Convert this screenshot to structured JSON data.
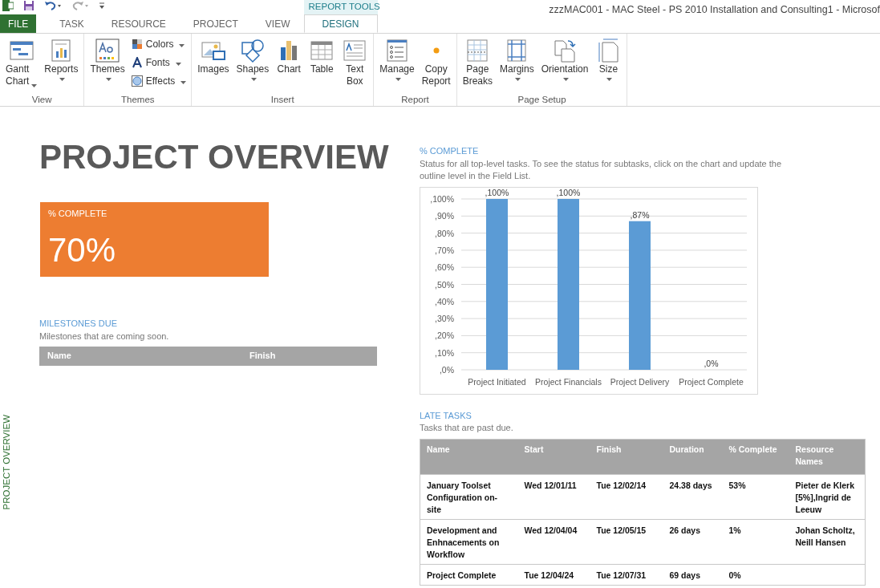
{
  "window": {
    "title": "zzzMAC001 - MAC Steel - PS 2010 Installation and Consulting1 - Microsof",
    "context_tab": "REPORT TOOLS"
  },
  "tabs": [
    {
      "label": "FILE",
      "kind": "file",
      "selected": false
    },
    {
      "label": "TASK",
      "kind": "tab",
      "selected": false
    },
    {
      "label": "RESOURCE",
      "kind": "tab",
      "selected": false
    },
    {
      "label": "PROJECT",
      "kind": "tab",
      "selected": false
    },
    {
      "label": "VIEW",
      "kind": "tab",
      "selected": false
    },
    {
      "label": "DESIGN",
      "kind": "context",
      "selected": true
    }
  ],
  "ribbon": [
    {
      "group": "View",
      "buttons": [
        {
          "label": "Gantt Chart",
          "kind": "large",
          "dropdown": true
        },
        {
          "label": "Reports",
          "kind": "large",
          "dropdown": true
        }
      ]
    },
    {
      "group": "Themes",
      "buttons": [
        {
          "label": "Themes",
          "kind": "large",
          "dropdown": true
        },
        {
          "label": "Colors",
          "kind": "small",
          "dropdown": true
        },
        {
          "label": "Fonts",
          "kind": "small",
          "dropdown": true
        },
        {
          "label": "Effects",
          "kind": "small",
          "dropdown": true
        }
      ]
    },
    {
      "group": "Insert",
      "buttons": [
        {
          "label": "Images",
          "kind": "large",
          "dropdown": false
        },
        {
          "label": "Shapes",
          "kind": "large",
          "dropdown": true
        },
        {
          "label": "Chart",
          "kind": "large",
          "dropdown": false
        },
        {
          "label": "Table",
          "kind": "large",
          "dropdown": false
        },
        {
          "label": "Text Box",
          "kind": "large",
          "dropdown": false
        }
      ]
    },
    {
      "group": "Report",
      "buttons": [
        {
          "label": "Manage",
          "kind": "large",
          "dropdown": true
        },
        {
          "label": "Copy Report",
          "kind": "large",
          "dropdown": false
        }
      ]
    },
    {
      "group": "Page Setup",
      "buttons": [
        {
          "label": "Page Breaks",
          "kind": "large",
          "dropdown": false
        },
        {
          "label": "Margins",
          "kind": "large",
          "dropdown": true
        },
        {
          "label": "Orientation",
          "kind": "large",
          "dropdown": true
        },
        {
          "label": "Size",
          "kind": "large",
          "dropdown": true
        }
      ]
    }
  ],
  "side_label": "PROJECT OVERVIEW",
  "report": {
    "title": "PROJECT OVERVIEW",
    "complete_tile": {
      "label": "% COMPLETE",
      "value": "70%",
      "color": "#ed7d31"
    },
    "milestones": {
      "heading": "MILESTONES DUE",
      "description": "Milestones that are coming soon.",
      "columns": [
        "Name",
        "Finish"
      ]
    },
    "percent_chart": {
      "heading": "% COMPLETE",
      "description": "Status for all top-level tasks. To see the status for subtasks, click on the chart and update the outline level in the Field List.",
      "chart_data": {
        "type": "bar",
        "categories": [
          "Project Initiated",
          "Project Financials",
          "Project Delivery",
          "Project Complete"
        ],
        "series": [
          {
            "color": "#5b9bd5",
            "values": [
              1,
              1,
              0.87,
              0
            ]
          }
        ],
        "grid": true,
        "ylim": [
          0,
          1
        ],
        "yticks": [
          {
            "value": 0,
            "label": ",0%"
          },
          {
            "value": 0.1,
            "label": ",10%"
          },
          {
            "value": 0.2,
            "label": ",20%"
          },
          {
            "value": 0.3,
            "label": ",30%"
          },
          {
            "value": 0.4,
            "label": ",40%"
          },
          {
            "value": 0.5,
            "label": ",50%"
          },
          {
            "value": 0.6,
            "label": ",60%"
          },
          {
            "value": 0.7,
            "label": ",70%"
          },
          {
            "value": 0.8,
            "label": ",80%"
          },
          {
            "value": 0.9,
            "label": ",90%"
          },
          {
            "value": 1,
            "label": ",100%"
          }
        ],
        "value_labels": [
          ",100%",
          ",100%",
          ",87%",
          ",0%"
        ]
      }
    },
    "late_tasks": {
      "heading": "LATE TASKS",
      "description": "Tasks that are past due.",
      "columns": [
        "Name",
        "Start",
        "Finish",
        "Duration",
        "% Complete",
        "Resource Names"
      ],
      "rows": [
        [
          "January Toolset Configuration on-site",
          "Wed 12/01/11",
          "Tue 12/02/14",
          "24.38 days",
          "53%",
          "Pieter de Klerk[5%],Ingrid de Leeuw"
        ],
        [
          "Development and Enhnacements on Workflow",
          "Wed 12/04/04",
          "Tue 12/05/15",
          "26 days",
          "1%",
          "Johan Scholtz,Neill Hansen"
        ],
        [
          "Project Complete",
          "Tue 12/04/24",
          "Tue 12/07/31",
          "69 days",
          "0%",
          ""
        ]
      ]
    }
  }
}
